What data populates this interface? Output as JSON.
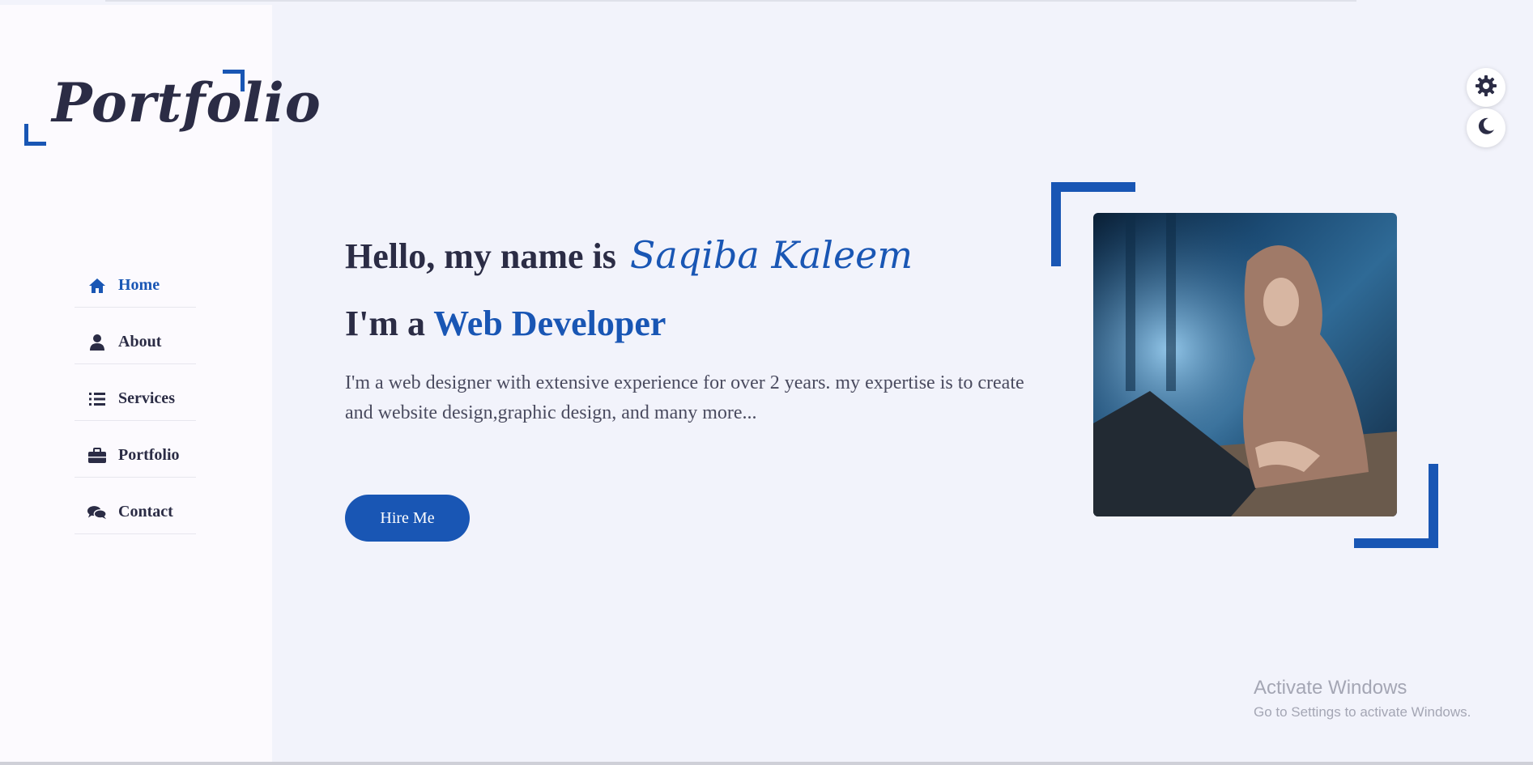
{
  "logo": {
    "text": "Portfolio"
  },
  "nav": {
    "items": [
      {
        "label": "Home",
        "icon": "home-icon",
        "active": true
      },
      {
        "label": "About",
        "icon": "user-icon"
      },
      {
        "label": "Services",
        "icon": "list-icon"
      },
      {
        "label": "Portfolio",
        "icon": "briefcase-icon"
      },
      {
        "label": "Contact",
        "icon": "comments-icon"
      }
    ]
  },
  "hero": {
    "greeting": "Hello, my name is",
    "name": "Saqiba Kaleem",
    "role_prefix": "I'm a",
    "role": "Web Developer",
    "description": "I'm a web designer with extensive experience for over 2 years. my expertise is to create and website design,graphic design, and many more...",
    "cta_label": "Hire Me"
  },
  "controls": {
    "settings_icon": "gear-icon",
    "theme_icon": "moon-icon"
  },
  "watermark": {
    "title": "Activate Windows",
    "subtitle": "Go to Settings to activate Windows."
  },
  "colors": {
    "accent": "#1956b4",
    "text": "#2b2c45",
    "background": "#f2f3fb"
  }
}
